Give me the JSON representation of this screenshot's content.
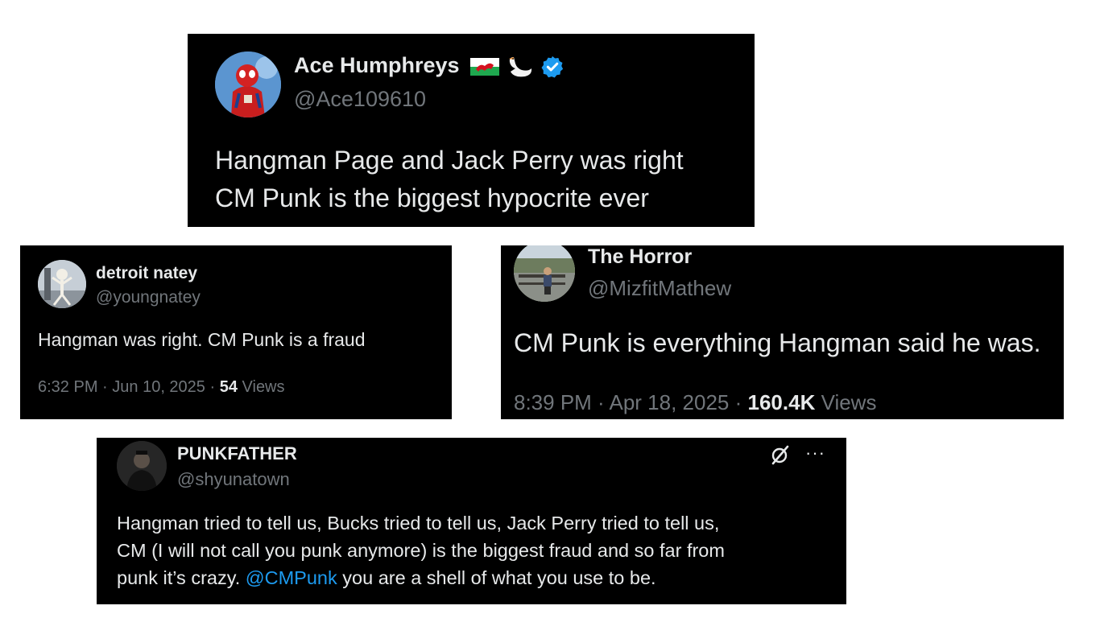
{
  "tweets": [
    {
      "name": "Ace Humphreys",
      "handle": "@Ace109610",
      "verified": true,
      "name_icons": [
        "wales-flag-icon",
        "swan-icon",
        "verified-badge-icon"
      ],
      "lines": [
        "Hangman Page and Jack Perry was right",
        "CM Punk is the biggest hypocrite ever"
      ]
    },
    {
      "name": "detroit natey",
      "handle": "@youngnatey",
      "text": "Hangman was right. CM Punk is a fraud",
      "time": "6:32 PM",
      "date": "Jun 10, 2025",
      "views": "54",
      "views_label": "Views"
    },
    {
      "name": "The Horror",
      "handle": "@MizfitMathew",
      "text": "CM Punk is everything Hangman said he was.",
      "time": "8:39 PM",
      "date": "Apr 18, 2025",
      "views": "160.4K",
      "views_label": "Views"
    },
    {
      "name": "PUNKFATHER",
      "handle": "@shyunatown",
      "line1": "Hangman tried to tell us, Bucks tried to tell us, Jack Perry tried to tell us,",
      "line2": "CM (I will not call you punk anymore) is the biggest fraud and so far from",
      "line3_pre": "punk it’s crazy. ",
      "mention": "@CMPunk",
      "line3_post": " you are a shell of what you use to be.",
      "more_label": "···"
    }
  ],
  "colors": {
    "card_bg": "#000000",
    "text": "#e7e9ea",
    "secondary": "#71767b",
    "mention": "#1d9bf0",
    "verified": "#1d9bf0"
  },
  "separator": " · "
}
